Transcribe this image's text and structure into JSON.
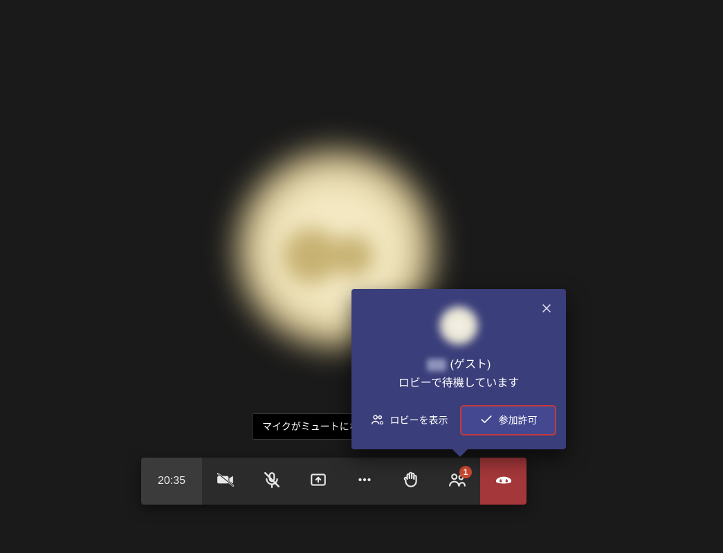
{
  "toast": {
    "mute_text": "マイクがミュートにな"
  },
  "lobby": {
    "guest_suffix": "(ゲスト)",
    "waiting_text": "ロビーで待機しています",
    "view_lobby_label": "ロビーを表示",
    "admit_label": "参加許可"
  },
  "controls": {
    "timer": "20:35",
    "people_badge": "1"
  },
  "colors": {
    "popup_bg": "#3a3e7a",
    "hangup_bg": "#a4373a",
    "highlight_outline": "#c43a3a"
  }
}
